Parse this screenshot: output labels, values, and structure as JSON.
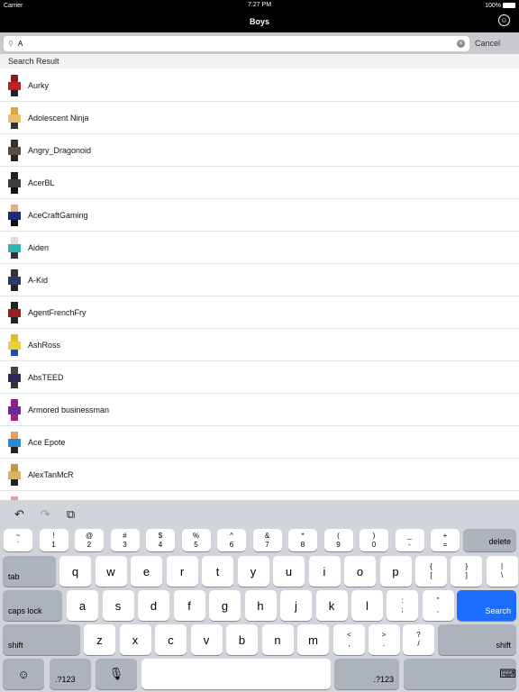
{
  "status": {
    "carrier": "Carrier",
    "time": "7:27 PM",
    "battery": "100%"
  },
  "nav": {
    "title": "Boys",
    "account_icon": "user-circle-icon"
  },
  "search": {
    "value": "A",
    "cancel": "Cancel"
  },
  "section": "Search Result",
  "results": [
    {
      "name": "Aurky",
      "colors": [
        "#8b1a1a",
        "#c0221f",
        "#222"
      ]
    },
    {
      "name": "Adolescent Ninja",
      "colors": [
        "#d9a441",
        "#e6c06b",
        "#333"
      ]
    },
    {
      "name": "Angry_Dragonoid",
      "colors": [
        "#3a2e2a",
        "#5a4a3f",
        "#222"
      ]
    },
    {
      "name": "AcerBL",
      "colors": [
        "#222",
        "#3c3c3c",
        "#111"
      ]
    },
    {
      "name": "AceCraftGaming",
      "colors": [
        "#e0b08a",
        "#1d2a7a",
        "#111"
      ]
    },
    {
      "name": "Aiden",
      "colors": [
        "#ddd",
        "#2fb6b0",
        "#333"
      ]
    },
    {
      "name": "A-Kid",
      "colors": [
        "#333",
        "#2a3a6a",
        "#222"
      ]
    },
    {
      "name": "AgentFrenchFry",
      "colors": [
        "#222",
        "#9b1c1c",
        "#222"
      ]
    },
    {
      "name": "AshRoss",
      "colors": [
        "#e0c020",
        "#e8d040",
        "#2a4f9a"
      ]
    },
    {
      "name": "AbsTEED",
      "colors": [
        "#444",
        "#2a2a5a",
        "#333"
      ]
    },
    {
      "name": "Armored businessman",
      "colors": [
        "#9a1a8a",
        "#6a2a9a",
        "#a0207a"
      ]
    },
    {
      "name": "Ace Epote",
      "colors": [
        "#e0a070",
        "#2a8ad0",
        "#222"
      ]
    },
    {
      "name": "AlexTanMcR",
      "colors": [
        "#c89040",
        "#e0b060",
        "#222"
      ]
    },
    {
      "name": "",
      "colors": [
        "#e0a0a0",
        "#d07070",
        "#fff"
      ]
    }
  ],
  "keyboard": {
    "toolbar": [
      "↶",
      "↷",
      "⧉"
    ],
    "row1": [
      [
        "~",
        "`"
      ],
      [
        "!",
        "1"
      ],
      [
        "@",
        "2"
      ],
      [
        "#",
        "3"
      ],
      [
        "$",
        "4"
      ],
      [
        "%",
        "5"
      ],
      [
        "^",
        "6"
      ],
      [
        "&",
        "7"
      ],
      [
        "*",
        "8"
      ],
      [
        "(",
        "9"
      ],
      [
        ")",
        "0"
      ],
      [
        "_",
        "-"
      ],
      [
        "+",
        "="
      ]
    ],
    "delete": "delete",
    "tab": "tab",
    "row2": [
      "q",
      "w",
      "e",
      "r",
      "t",
      "y",
      "u",
      "i",
      "o",
      "p"
    ],
    "row2sym": [
      [
        "{",
        "["
      ],
      [
        "}",
        "]"
      ],
      [
        "|",
        "\\"
      ]
    ],
    "caps": "caps lock",
    "row3": [
      "a",
      "s",
      "d",
      "f",
      "g",
      "h",
      "j",
      "k",
      "l"
    ],
    "row3sym": [
      [
        ":",
        ";"
      ],
      [
        "\"",
        ","
      ]
    ],
    "search": "Search",
    "shift": "shift",
    "row4": [
      "z",
      "x",
      "c",
      "v",
      "b",
      "n",
      "m"
    ],
    "row4sym": [
      [
        "<",
        ","
      ],
      [
        ">",
        "."
      ],
      [
        "?",
        "/"
      ]
    ],
    "emoji": "☺",
    "num": ".?123",
    "mic": "🎙",
    "hide": "⌨"
  }
}
